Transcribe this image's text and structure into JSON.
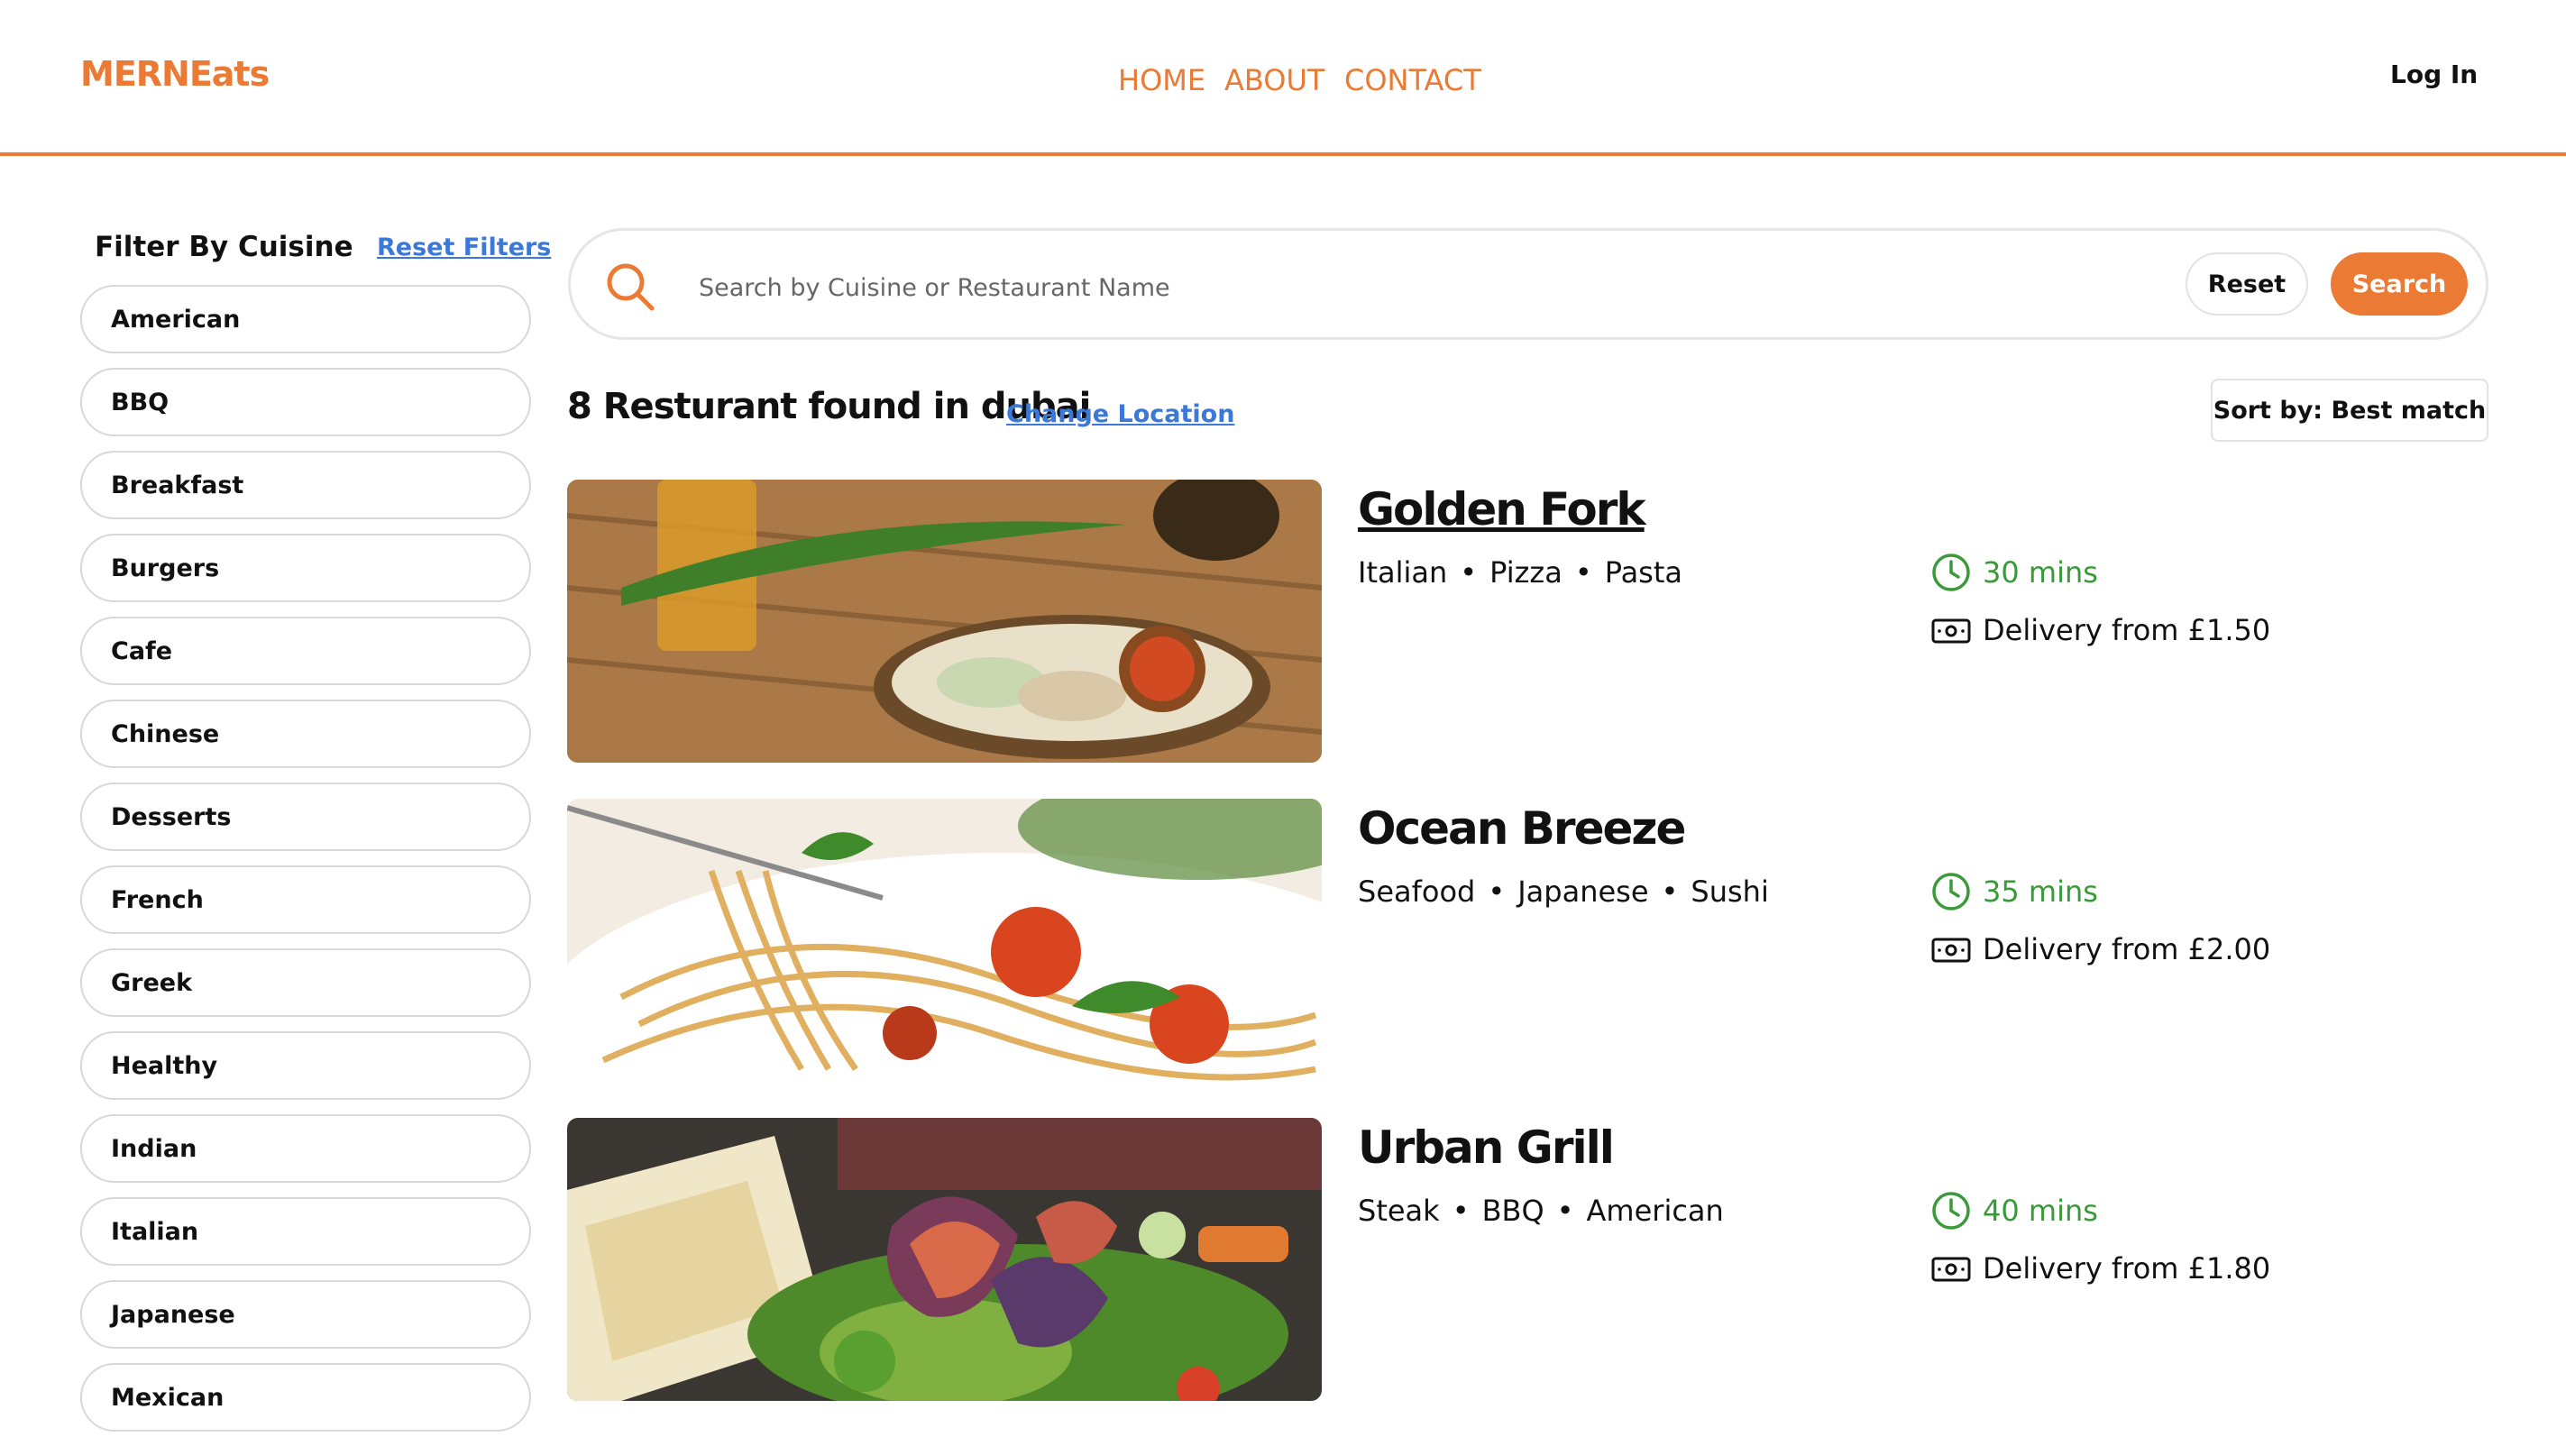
{
  "header": {
    "logo": "MERNEats",
    "nav": [
      "HOME",
      "ABOUT",
      "CONTACT"
    ],
    "login": "Log In"
  },
  "sidebar": {
    "title": "Filter By Cuisine",
    "reset_label": "Reset Filters",
    "cuisines": [
      "American",
      "BBQ",
      "Breakfast",
      "Burgers",
      "Cafe",
      "Chinese",
      "Desserts",
      "French",
      "Greek",
      "Healthy",
      "Indian",
      "Italian",
      "Japanese",
      "Mexican"
    ]
  },
  "search": {
    "placeholder": "Search by Cuisine or Restaurant Name",
    "reset_label": "Reset",
    "search_label": "Search"
  },
  "results": {
    "count_text": "8 Resturant found in dubai",
    "change_location": "Change Location",
    "sort_label": "Sort by: Best match"
  },
  "restaurants": [
    {
      "name": "Golden Fork",
      "cuisines": [
        "Italian",
        "Pizza",
        "Pasta"
      ],
      "time": "30 mins",
      "delivery": "Delivery from £1.50"
    },
    {
      "name": "Ocean Breeze",
      "cuisines": [
        "Seafood",
        "Japanese",
        "Sushi"
      ],
      "time": "35 mins",
      "delivery": "Delivery from £2.00"
    },
    {
      "name": "Urban Grill",
      "cuisines": [
        "Steak",
        "BBQ",
        "American"
      ],
      "time": "40 mins",
      "delivery": "Delivery from £1.80"
    }
  ],
  "colors": {
    "accent": "#ea7a34",
    "link": "#3b78d8",
    "time_green": "#3a9a3a"
  },
  "icons": {
    "search": "search-icon",
    "clock": "clock-icon",
    "money": "banknote-icon"
  }
}
